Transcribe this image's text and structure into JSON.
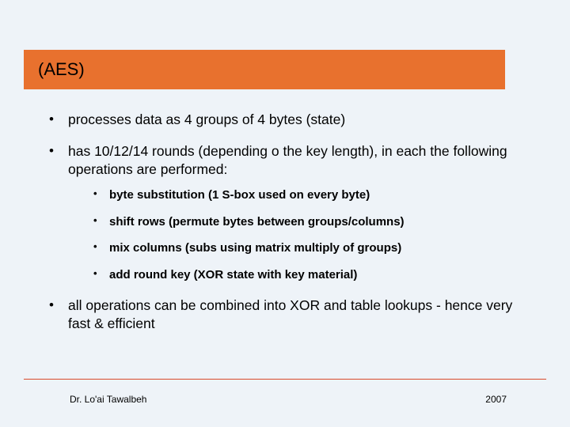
{
  "title": "(AES)",
  "bullets": {
    "b1": "processes data as 4 groups of 4 bytes (state)",
    "b2": "has 10/12/14 rounds (depending o the key length), in each the following operations are performed:",
    "b2_sub": {
      "s1": "byte substitution (1 S-box used on every byte)",
      "s2": "shift rows (permute bytes between groups/columns)",
      "s3": "mix columns (subs using matrix multiply of groups)",
      "s4": "add round key (XOR state with key material)"
    },
    "b3": "all operations can be combined into XOR and table lookups - hence very fast & efficient"
  },
  "footer": {
    "author": "Dr. Lo'ai Tawalbeh",
    "year": "2007"
  }
}
